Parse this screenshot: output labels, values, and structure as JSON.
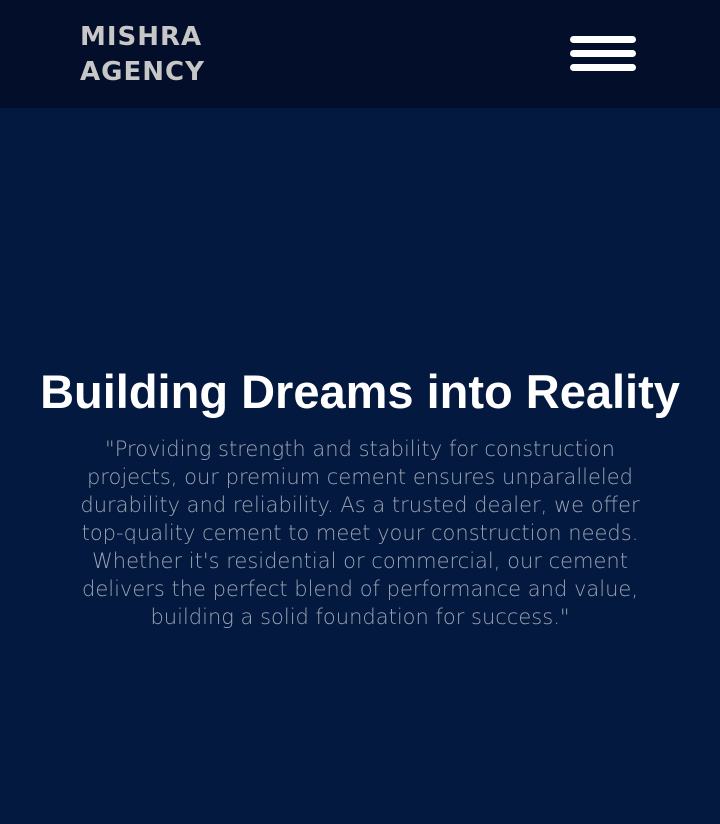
{
  "header": {
    "logo_line1": "MISHRA",
    "logo_line2": "AGENCY",
    "menu_icon": "hamburger-menu-icon"
  },
  "hero": {
    "title": "Building Dreams into Reality",
    "description": "\"Providing strength and stability for construction projects, our premium cement ensures unparalleled durability and reliability. As a trusted dealer, we offer top-quality cement to meet your construction needs. Whether it's residential or commercial, our cement delivers the perfect blend of performance and value, building a solid foundation for success.\""
  },
  "colors": {
    "header_bg": "#030e2b",
    "hero_bg": "#03193f",
    "title": "#ffffff",
    "body_text": "#9aa3b3",
    "logo": "#c7c7c7"
  }
}
